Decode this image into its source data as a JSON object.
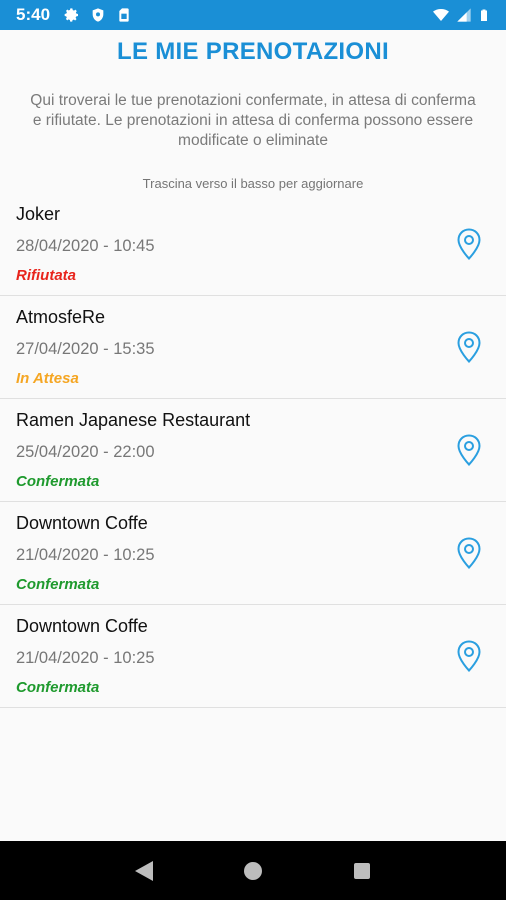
{
  "status_bar": {
    "time": "5:40",
    "icons": [
      "gear-icon",
      "shield-icon",
      "sim-card-icon",
      "wifi-icon",
      "signal-icon",
      "battery-icon"
    ]
  },
  "header": {
    "title": "LE MIE PRENOTAZIONI"
  },
  "intro": {
    "text": "Qui troverai le tue prenotazioni confermate, in attesa di conferma e rifiutate. Le prenotazioni in attesa di conferma possono essere modificate o eliminate"
  },
  "list": {
    "refresh_hint": "Trascina verso il basso per aggiornare",
    "items": [
      {
        "name": "Joker",
        "datetime": "28/04/2020 - 10:45",
        "status": "Rifiutata"
      },
      {
        "name": "AtmosfeRe",
        "datetime": "27/04/2020 - 15:35",
        "status": "In Attesa"
      },
      {
        "name": "Ramen Japanese Restaurant",
        "datetime": "25/04/2020 - 22:00",
        "status": "Confermata"
      },
      {
        "name": "Downtown Coffe",
        "datetime": "21/04/2020 - 10:25",
        "status": "Confermata"
      },
      {
        "name": "Downtown Coffe",
        "datetime": "21/04/2020 - 10:25",
        "status": "Confermata"
      }
    ]
  },
  "colors": {
    "accent": "#1a8fd6",
    "rejected": "#e8241c",
    "pending": "#f5a623",
    "confirmed": "#1f9a2e"
  },
  "nav": {
    "icons": [
      "back-icon",
      "home-icon",
      "recents-icon"
    ]
  }
}
